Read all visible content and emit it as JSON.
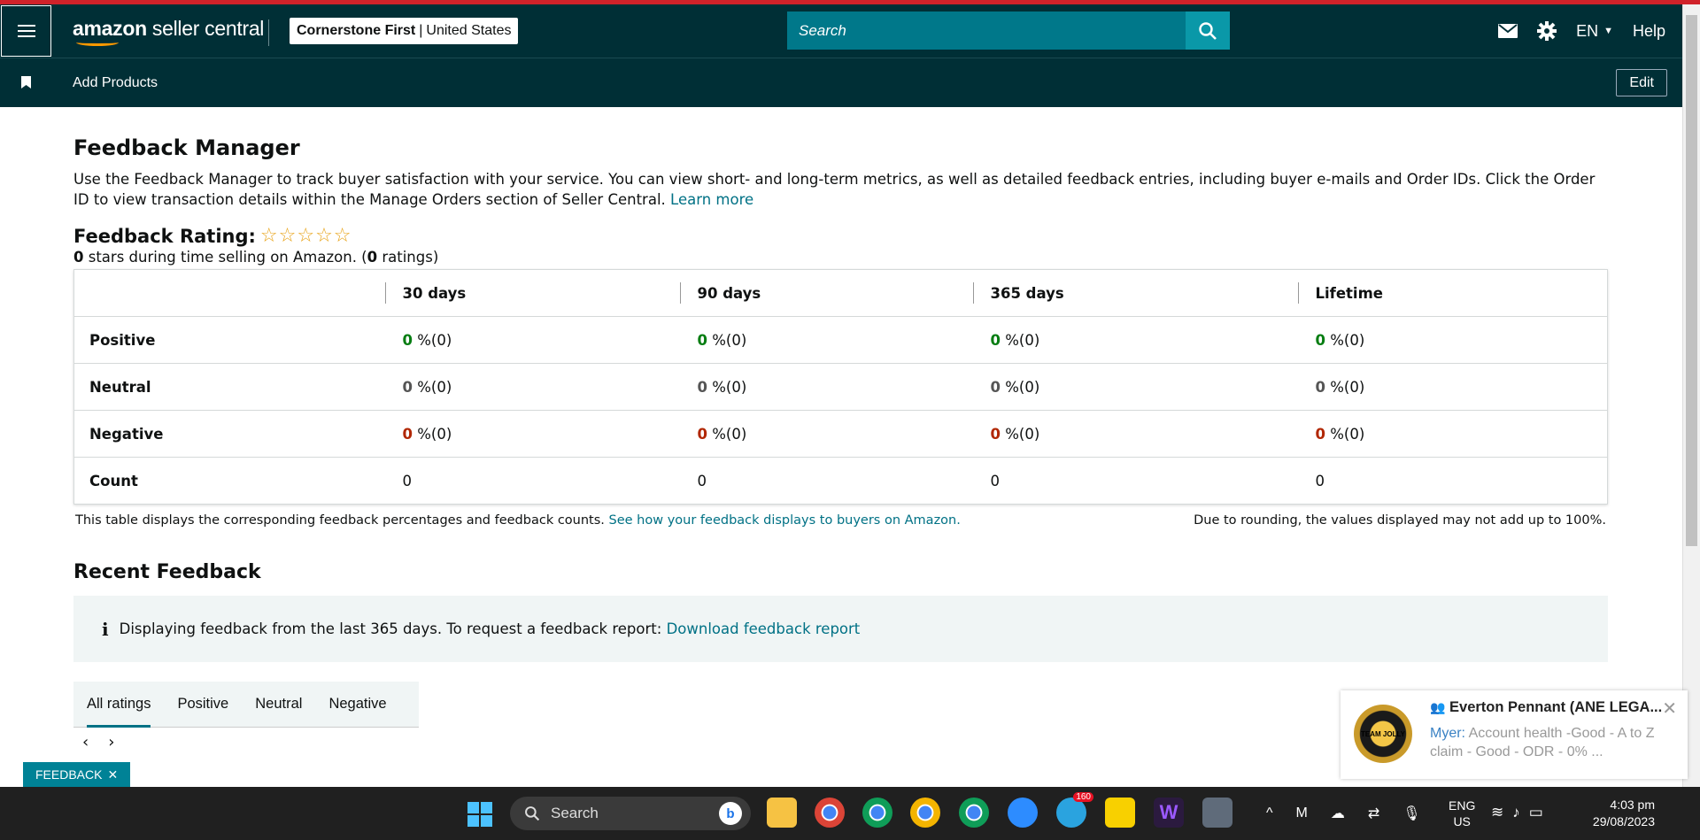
{
  "header": {
    "logo_text_bold": "amazon",
    "logo_text_rest": " seller central",
    "store_name": "Cornerstone First",
    "store_region": "United States",
    "search_placeholder": "Search",
    "lang": "EN",
    "help": "Help"
  },
  "subnav": {
    "add_products": "Add Products",
    "edit": "Edit"
  },
  "page": {
    "title": "Feedback Manager",
    "intro": "Use the Feedback Manager to track buyer satisfaction with your service. You can view short- and long-term metrics, as well as detailed feedback entries, including buyer e-mails and Order IDs. Click the Order ID to view transaction details within the Manage Orders section of Seller Central.",
    "learn_more": "Learn more",
    "rating_title": "Feedback Rating:",
    "stars": "☆☆☆☆☆",
    "rating_stars_value": "0",
    "rating_sub_mid": " stars during time selling on Amazon. (",
    "rating_count": "0",
    "rating_sub_end": " ratings)"
  },
  "table": {
    "columns": [
      "30 days",
      "90 days",
      "365 days",
      "Lifetime"
    ],
    "rows": [
      {
        "label": "Positive",
        "cells": [
          [
            "0",
            " %(0)"
          ],
          [
            "0",
            " %(0)"
          ],
          [
            "0",
            " %(0)"
          ],
          [
            "0",
            " %(0)"
          ]
        ]
      },
      {
        "label": "Neutral",
        "cells": [
          [
            "0",
            " %(0)"
          ],
          [
            "0",
            " %(0)"
          ],
          [
            "0",
            " %(0)"
          ],
          [
            "0",
            " %(0)"
          ]
        ]
      },
      {
        "label": "Negative",
        "cells": [
          [
            "0",
            " %(0)"
          ],
          [
            "0",
            " %(0)"
          ],
          [
            "0",
            " %(0)"
          ],
          [
            "0",
            " %(0)"
          ]
        ]
      },
      {
        "label": "Count",
        "cells": [
          [
            "",
            "0"
          ],
          [
            "",
            "0"
          ],
          [
            "",
            "0"
          ],
          [
            "",
            "0"
          ]
        ]
      }
    ],
    "note_left": "This table displays the corresponding feedback percentages and feedback counts.",
    "note_link": "See how your feedback displays to buyers on Amazon.",
    "note_right": "Due to rounding, the values displayed may not add up to 100%."
  },
  "recent": {
    "title": "Recent Feedback",
    "info_text": "Displaying feedback from the last 365 days. To request a feedback report:",
    "info_link": "Download feedback report",
    "tabs": [
      "All ratings",
      "Positive",
      "Neutral",
      "Negative"
    ],
    "active_tab": "All ratings"
  },
  "feedback_chip": "FEEDBACK",
  "notification": {
    "name": "Everton Pennant (ANE LEGA...",
    "sender": "Myer:",
    "message": "Account health  -Good     -  A to Z claim - Good    - ODR - 0% ...",
    "avatar_text": "TEAM JOLLY"
  },
  "taskbar": {
    "search": "Search",
    "lang_top": "ENG",
    "lang_bottom": "US",
    "time": "4:03 pm",
    "date": "29/08/2023",
    "badge": "160"
  },
  "colors": {
    "header_bg": "#002f36",
    "link": "#007185",
    "positive": "#067d12",
    "negative": "#b12704",
    "star": "#e8a317"
  }
}
